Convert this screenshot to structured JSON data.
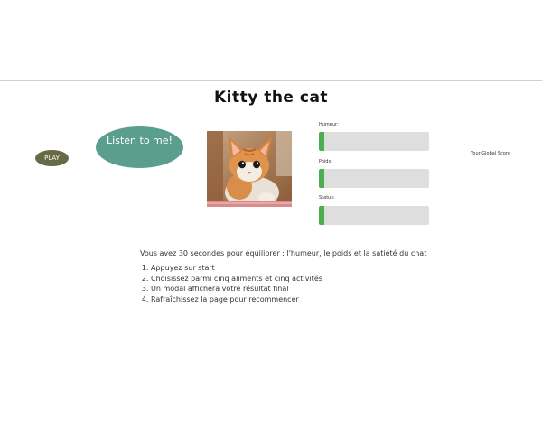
{
  "header": {
    "title": "Kitty the cat"
  },
  "controls": {
    "play_label": "PLAY",
    "listen_label": "Listen to me!"
  },
  "stats": [
    {
      "label": "Humeur:",
      "level_percent": 5
    },
    {
      "label": "Poids:",
      "level_percent": 5
    },
    {
      "label": "Status:",
      "level_percent": 5
    }
  ],
  "score": {
    "label": "Your Global Score"
  },
  "instructions": {
    "intro": "Vous avez 30 secondes pour équilibrer : l'humeur, le poids et la satiété du chat",
    "steps": [
      "Appuyez sur start",
      "Choisissez parmi cinq aliments et cinq activités",
      "Un modal affichera votre résultat final",
      "Rafraîchissez la page pour recommencer"
    ]
  },
  "colors": {
    "play_button": "#676a45",
    "listen_button": "#5a9e8f",
    "bar_track": "#dedede",
    "bar_fill": "#4cae4c"
  }
}
